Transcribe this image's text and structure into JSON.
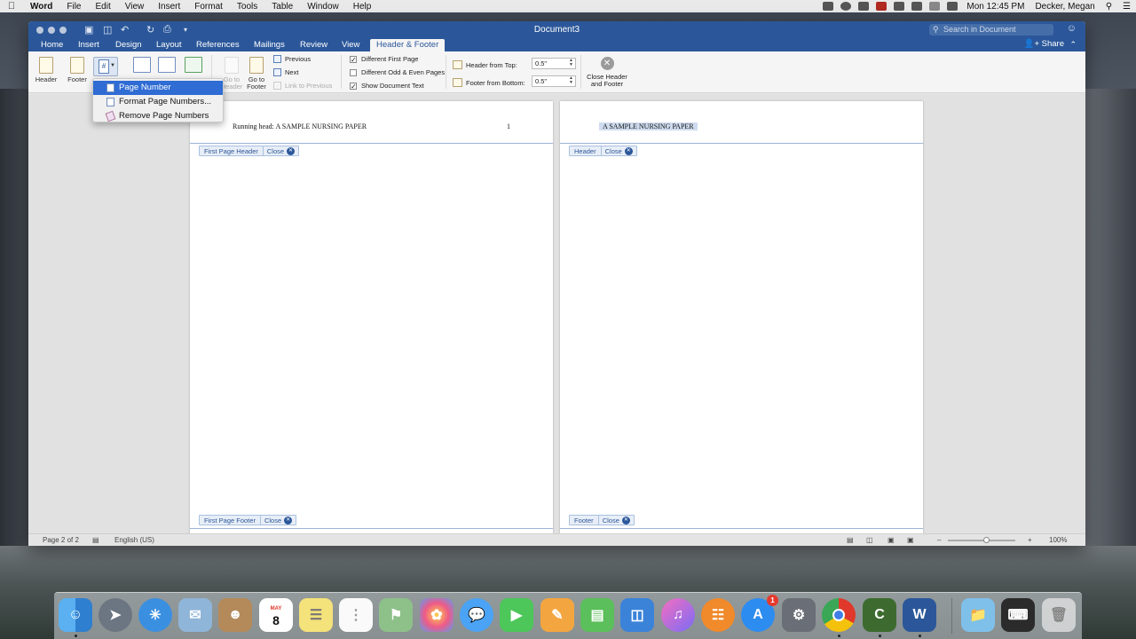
{
  "menubar": {
    "app_name": "Word",
    "items": [
      "File",
      "Edit",
      "View",
      "Insert",
      "Format",
      "Tools",
      "Table",
      "Window",
      "Help"
    ],
    "clock": "Mon 12:45 PM",
    "user": "Decker, Megan"
  },
  "window": {
    "title": "Document3",
    "search_placeholder": "Search in Document",
    "share_label": "Share"
  },
  "tabs": [
    "Home",
    "Insert",
    "Design",
    "Layout",
    "References",
    "Mailings",
    "Review",
    "View",
    "Header & Footer"
  ],
  "ribbon": {
    "header_label": "Header",
    "footer_label": "Footer",
    "go_to_header": "Go to Header",
    "go_to_footer": "Go to Footer",
    "previous": "Previous",
    "next": "Next",
    "link_to_previous": "Link to Previous",
    "different_first_page": "Different First Page",
    "different_odd_even": "Different Odd & Even Pages",
    "show_document_text": "Show Document Text",
    "header_from_top_label": "Header from Top:",
    "header_from_top_value": "0.5\"",
    "footer_from_bottom_label": "Footer from Bottom:",
    "footer_from_bottom_value": "0.5\"",
    "close_header_footer": "Close Header and Footer",
    "checks": {
      "different_first_page": true,
      "different_odd_even": false,
      "show_document_text": true
    }
  },
  "dropdown": {
    "items": [
      "Page Number",
      "Format Page Numbers...",
      "Remove Page Numbers"
    ]
  },
  "pages": [
    {
      "header_text": "Running head: A SAMPLE NURSING PAPER",
      "page_number": "1",
      "header_tag": "First Page Header",
      "footer_tag": "First Page Footer",
      "close_label": "Close"
    },
    {
      "header_text": "A SAMPLE NURSING PAPER",
      "header_tag": "Header",
      "footer_tag": "Footer",
      "close_label": "Close"
    }
  ],
  "statusbar": {
    "page_info": "Page 2 of 2",
    "language": "English (US)",
    "zoom": "100%"
  },
  "dock": {
    "calendar_month": "MAY",
    "calendar_day": "8",
    "app_store_badge": "1",
    "apps": [
      "finder-icon",
      "launchpad-icon",
      "safari-icon",
      "mail-icon",
      "contacts-icon",
      "calendar-icon",
      "notes-icon",
      "reminders-icon",
      "maps-icon",
      "photos-icon",
      "messages-icon",
      "facetime-icon",
      "pages-icon",
      "numbers-icon",
      "keynote-icon",
      "itunes-icon",
      "ibooks-icon",
      "app-store-icon",
      "system-preferences-icon",
      "chrome-icon",
      "camtasia-icon",
      "word-icon",
      "downloads-folder-icon",
      "terminal-icon",
      "trash-icon"
    ]
  }
}
